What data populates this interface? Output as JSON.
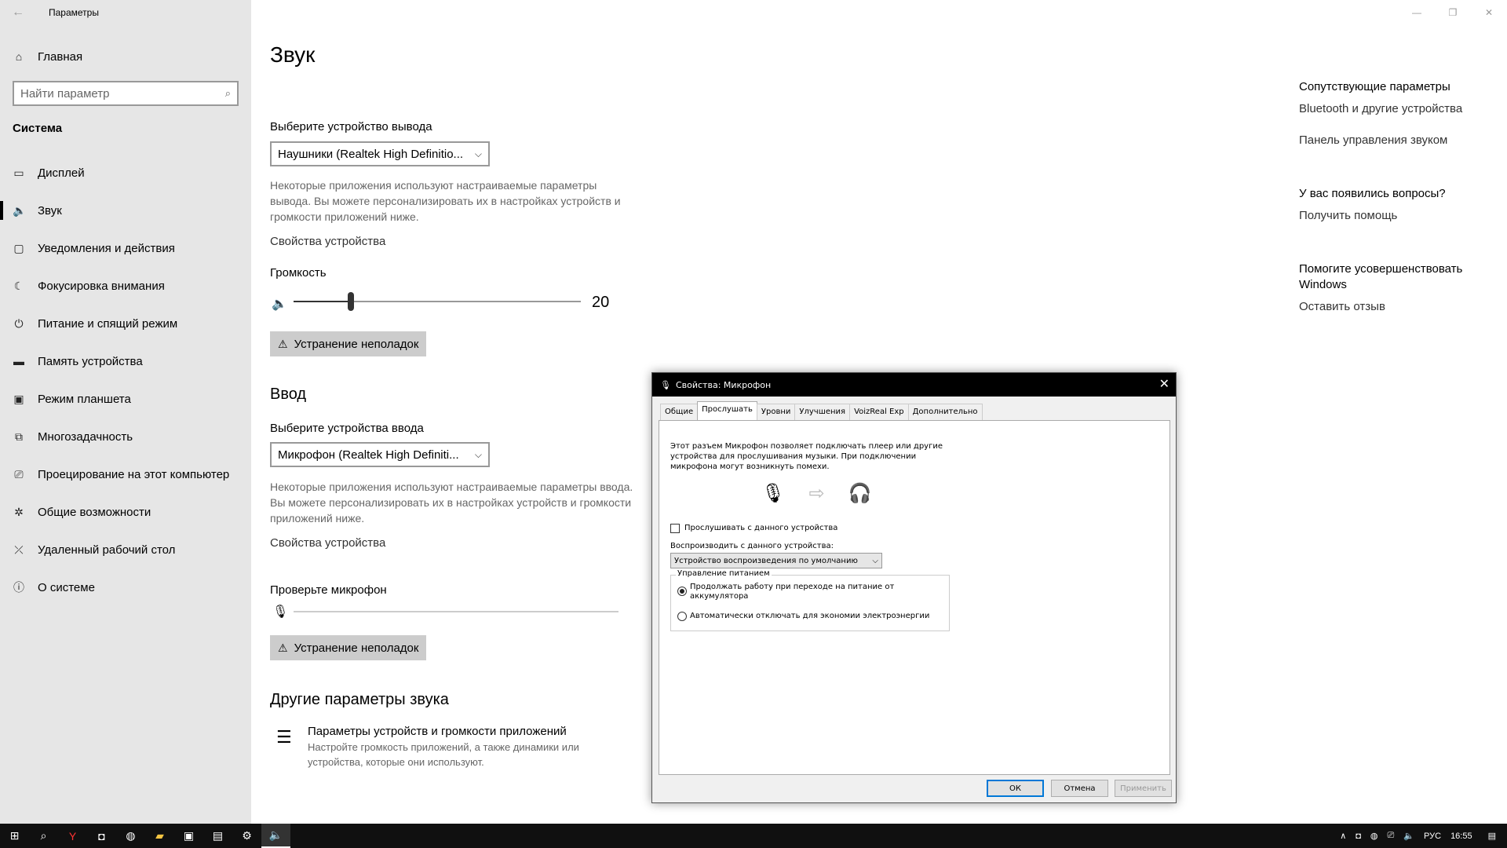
{
  "app": {
    "title": "Параметры"
  },
  "sidebar": {
    "home_label": "Главная",
    "search_placeholder": "Найти параметр",
    "section_title": "Система",
    "items": [
      {
        "label": "Дисплей",
        "icon": "monitor-icon"
      },
      {
        "label": "Звук",
        "icon": "speaker-icon",
        "active": true
      },
      {
        "label": "Уведомления и действия",
        "icon": "notification-icon"
      },
      {
        "label": "Фокусировка внимания",
        "icon": "moon-icon"
      },
      {
        "label": "Питание и спящий режим",
        "icon": "power-icon"
      },
      {
        "label": "Память устройства",
        "icon": "storage-icon"
      },
      {
        "label": "Режим планшета",
        "icon": "tablet-icon"
      },
      {
        "label": "Многозадачность",
        "icon": "multitask-icon"
      },
      {
        "label": "Проецирование на этот компьютер",
        "icon": "project-icon"
      },
      {
        "label": "Общие возможности",
        "icon": "shared-icon"
      },
      {
        "label": "Удаленный рабочий стол",
        "icon": "remote-icon"
      },
      {
        "label": "О системе",
        "icon": "info-icon"
      }
    ]
  },
  "main": {
    "title": "Звук",
    "output": {
      "label": "Выберите устройство вывода",
      "selected": "Наушники (Realtek High Definitio...",
      "help": "Некоторые приложения используют настраиваемые параметры вывода. Вы можете персонализировать их в настройках устройств и громкости приложений ниже.",
      "device_props": "Свойства устройства",
      "volume_label": "Громкость",
      "volume_value": "20",
      "volume": 20,
      "troubleshoot": "Устранение неполадок"
    },
    "input": {
      "heading": "Ввод",
      "label": "Выберите устройства ввода",
      "selected": "Микрофон (Realtek High Definiti...",
      "help": "Некоторые приложения используют настраиваемые параметры ввода. Вы можете персонализировать их в настройках устройств и громкости приложений ниже.",
      "device_props": "Свойства устройства",
      "test_label": "Проверьте микрофон",
      "troubleshoot": "Устранение неполадок"
    },
    "other": {
      "heading": "Другие параметры звука",
      "item_title": "Параметры устройств и громкости приложений",
      "item_desc": "Настройте громкость приложений, а также динамики или устройства, которые они используют."
    },
    "related": {
      "heading": "Сопутствующие параметры",
      "link1": "Bluetooth и другие устройства",
      "link2": "Панель управления звуком",
      "questions_heading": "У вас появились вопросы?",
      "help_link": "Получить помощь",
      "improve_heading": "Помогите усовершенствовать Windows",
      "feedback_link": "Оставить отзыв"
    }
  },
  "dialog": {
    "title": "Свойства: Микрофон",
    "tabs": [
      "Общие",
      "Прослушать",
      "Уровни",
      "Улучшения",
      "VoizReal Exp",
      "Дополнительно"
    ],
    "active_tab": 1,
    "intro": "Этот разъем Микрофон позволяет подключать плеер или другие устройства для прослушивания музыки. При подключении микрофона могут возникнуть помехи.",
    "listen_checkbox": "Прослушивать с данного устройства",
    "playback_label": "Воспроизводить с данного устройства:",
    "playback_selected": "Устройство воспроизведения по умолчанию",
    "power_group": "Управление питанием",
    "radio1": "Продолжать работу при переходе на питание от аккумулятора",
    "radio2": "Автоматически отключать для экономии электроэнергии",
    "ok": "ОК",
    "cancel": "Отмена",
    "apply": "Применить"
  },
  "taskbar": {
    "lang": "РУС",
    "time": "16:55"
  }
}
